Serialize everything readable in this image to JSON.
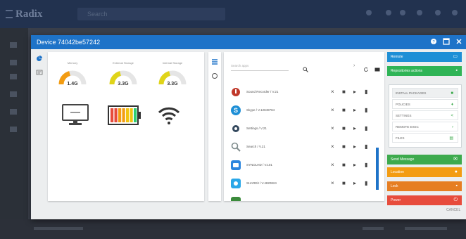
{
  "app": {
    "logo": "Radix",
    "search_placeholder": "Search"
  },
  "dialog": {
    "title": "Device 74042be57242",
    "cancel_label": "CANCEL"
  },
  "stats": {
    "gauges": [
      {
        "label": "Memory",
        "value": "1.4G",
        "color": "#f39c12",
        "fraction": 0.42
      },
      {
        "label": "External Storage",
        "value": "3.3G",
        "color": "#e0d419",
        "fraction": 0.42
      },
      {
        "label": "Internal Storage",
        "value": "3.3G",
        "color": "#e0d419",
        "fraction": 0.42
      }
    ],
    "battery_colors": [
      "#e74c3c",
      "#e74c3c",
      "#f39c12",
      "#f39c12",
      "#f1c40f",
      "#f1c40f",
      "#2ecc71"
    ]
  },
  "apps": {
    "search_placeholder": "Search apps",
    "items": [
      {
        "name": "Sound Recorder / V.21",
        "icon": "recorder-icon",
        "color": "#c0392b"
      },
      {
        "name": "Skype / V.12849784",
        "icon": "skype-icon",
        "color": "#1e8fd6"
      },
      {
        "name": "Settings / V.21",
        "icon": "settings-icon",
        "color": "#34495e"
      },
      {
        "name": "Search / V.21",
        "icon": "search-icon",
        "color": "#7f8c8d"
      },
      {
        "name": "SYNOLHD / V.101",
        "icon": "sync-icon",
        "color": "#2e86de"
      },
      {
        "name": "SHAREit / V.4820824",
        "icon": "shareit-icon",
        "color": "#2aa7e8"
      }
    ]
  },
  "actions": {
    "remote": {
      "label": "Remote",
      "color": "#1e8fd6"
    },
    "repositories": {
      "label": "Repositories actions",
      "color": "#2fb456"
    },
    "subitems": [
      {
        "label": "INSTALL PACKAGES"
      },
      {
        "label": "POLICIES"
      },
      {
        "label": "SETTINGS"
      },
      {
        "label": "REMOTE EXEC"
      },
      {
        "label": "FILES"
      }
    ],
    "send_message": {
      "label": "Send Message",
      "color": "#3daa4d"
    },
    "location": {
      "label": "Location",
      "color": "#f39c12"
    },
    "lock": {
      "label": "Lock",
      "color": "#e67e22"
    },
    "power": {
      "label": "Power",
      "color": "#e74c3c"
    }
  }
}
